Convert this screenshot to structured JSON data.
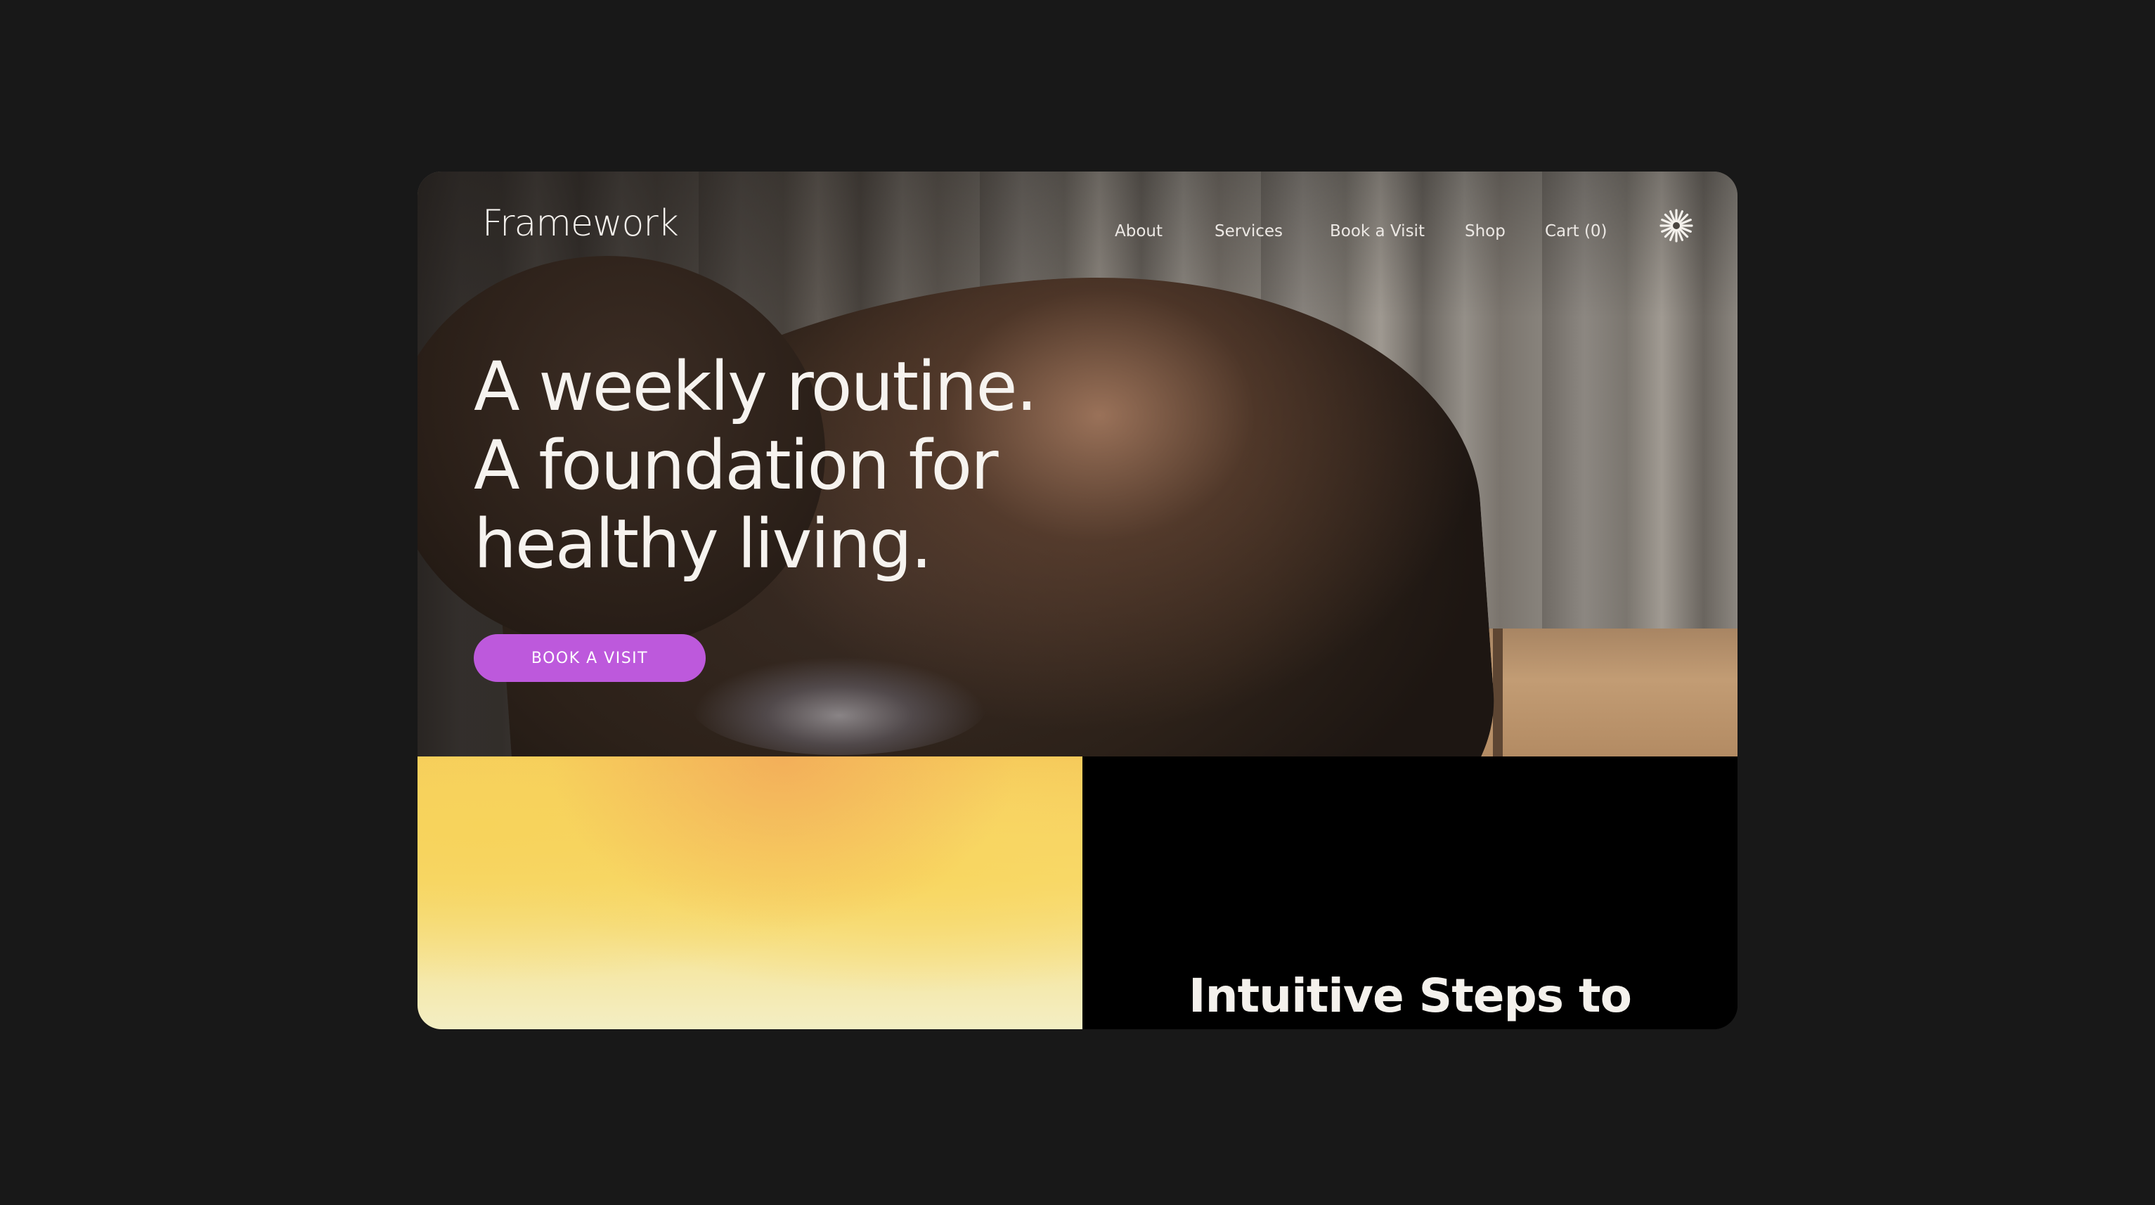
{
  "brand": {
    "logo": "Framework"
  },
  "nav": {
    "items": [
      {
        "label": "About"
      },
      {
        "label": "Services"
      },
      {
        "label": "Book a Visit"
      },
      {
        "label": "Shop"
      },
      {
        "label": "Cart (0)"
      }
    ],
    "menu_icon": "asterisk-burst-icon"
  },
  "hero": {
    "headline_lines": [
      "A weekly routine.",
      "A foundation for",
      "healthy living."
    ],
    "cta_label": "BOOK A VISIT"
  },
  "section": {
    "title": "Intuitive Steps to"
  },
  "colors": {
    "page_background": "#181818",
    "cta": "#bd59dc",
    "panel_yellow": "#f7d35b",
    "panel_black": "#000000",
    "text_light": "#f4f1ec"
  }
}
